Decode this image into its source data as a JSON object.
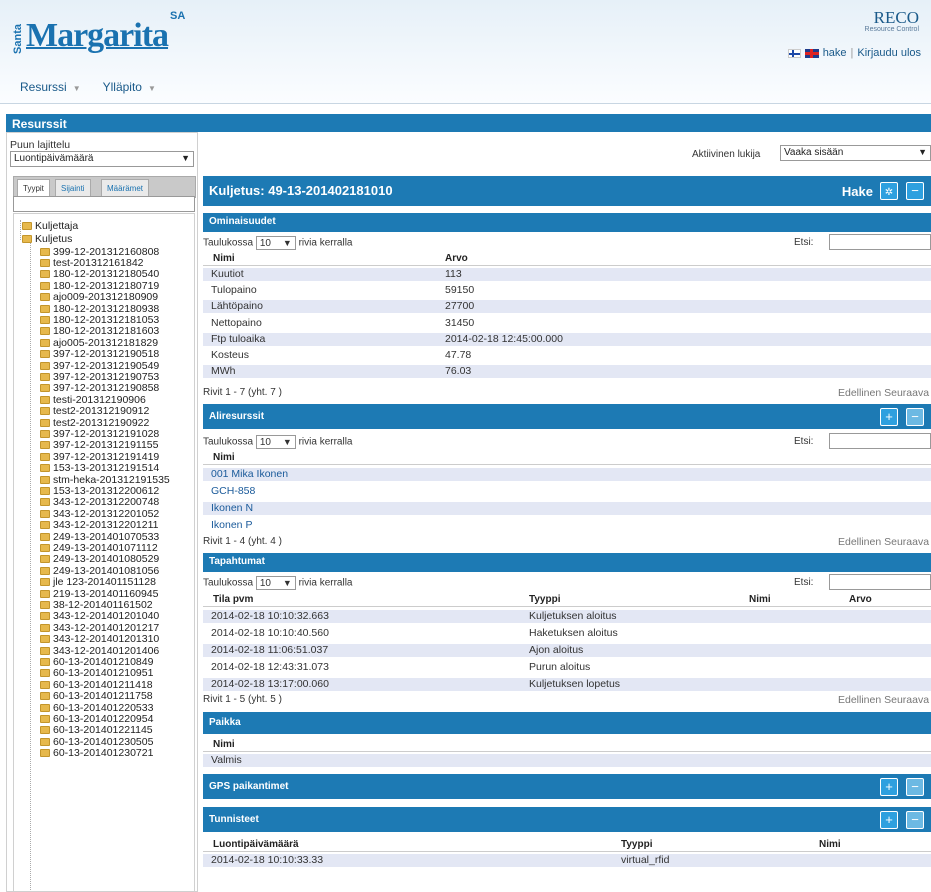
{
  "header": {
    "logo_vertical": "Santa",
    "logo_main": "Margarita",
    "logo_sup": "SA",
    "app_title": "RECO",
    "app_subtitle": "Resource Control",
    "link_hake": "hake",
    "separator": "|",
    "link_logout": "Kirjaudu ulos"
  },
  "menu": {
    "items": [
      "Resurssi",
      "Ylläpito"
    ],
    "arrow": "▼"
  },
  "resources_bar": "Resurssit",
  "tree_sort": {
    "label": "Puun lajittelu",
    "value": "Luontipäivämäärä"
  },
  "tabs": [
    "Tyypit",
    "Sijainti",
    "Määrämet"
  ],
  "tree": {
    "root_nodes": [
      "Kuljettaja",
      "Kuljetus"
    ],
    "children": [
      "399-12-201312160808",
      "test-201312161842",
      "180-12-201312180540",
      "180-12-201312180719",
      "ajo009-201312180909",
      "180-12-201312180938",
      "180-12-201312181053",
      "180-12-201312181603",
      "ajo005-201312181829",
      "397-12-201312190518",
      "397-12-201312190549",
      "397-12-201312190753",
      "397-12-201312190858",
      "testi-201312190906",
      "test2-201312190912",
      "test2-201312190922",
      "397-12-201312191028",
      "397-12-201312191155",
      "397-12-201312191419",
      "153-13-201312191514",
      "stm-heka-201312191535",
      "153-13-201312200612",
      "343-12-201312200748",
      "343-12-201312201052",
      "343-12-201312201211",
      "249-13-201401070533",
      "249-13-201401071112",
      "249-13-201401080529",
      "249-13-201401081056",
      "jle 123-201401151128",
      "219-13-201401160945",
      "38-12-201401161502",
      "343-12-201401201040",
      "343-12-201401201217",
      "343-12-201401201310",
      "343-12-201401201406",
      "60-13-201401210849",
      "60-13-201401210951",
      "60-13-201401211418",
      "60-13-201401211758",
      "60-13-201401220533",
      "60-13-201401220954",
      "60-13-201401221145",
      "60-13-201401230505",
      "60-13-201401230721"
    ]
  },
  "reader": {
    "label": "Aktiivinen lukija",
    "value": "Vaaka sisään"
  },
  "main": {
    "title": "Kuljetus: 49-13-201402181010",
    "hake_label": "Hake",
    "gear_icon": "✲",
    "minus_icon": "−"
  },
  "ominaisuudet": {
    "title": "Ominaisuudet",
    "show_prefix": "Taulukossa",
    "show_count": "10",
    "show_suffix": "rivia kerralla",
    "search_label": "Etsi:",
    "cols": [
      "Nimi",
      "Arvo"
    ],
    "rows": [
      [
        "Kuutiot",
        "113"
      ],
      [
        "Tulopaino",
        "59150"
      ],
      [
        "Lähtöpaino",
        "27700"
      ],
      [
        "Nettopaino",
        "31450"
      ],
      [
        "Ftp tuloaika",
        "2014-02-18 12:45:00.000"
      ],
      [
        "Kosteus",
        "47.78"
      ],
      [
        "MWh",
        "76.03"
      ]
    ],
    "info": "Rivit 1 - 7 (yht. 7 )",
    "prev": "Edellinen",
    "next": "Seuraava"
  },
  "aliresurssit": {
    "title": "Aliresurssit",
    "show_prefix": "Taulukossa",
    "show_count": "10",
    "show_suffix": "rivia kerralla",
    "search_label": "Etsi:",
    "cols": [
      "Nimi"
    ],
    "rows": [
      "001 Mika Ikonen",
      "GCH-858",
      "Ikonen N",
      "Ikonen P"
    ],
    "info": "Rivit 1 - 4 (yht. 4 )",
    "prev": "Edellinen",
    "next": "Seuraava"
  },
  "tapahtumat": {
    "title": "Tapahtumat",
    "show_prefix": "Taulukossa",
    "show_count": "10",
    "show_suffix": "rivia kerralla",
    "search_label": "Etsi:",
    "cols": [
      "Tila pvm",
      "Tyyppi",
      "Nimi",
      "Arvo"
    ],
    "rows": [
      [
        "2014-02-18 10:10:32.663",
        "Kuljetuksen aloitus"
      ],
      [
        "2014-02-18 10:10:40.560",
        "Haketuksen aloitus"
      ],
      [
        "2014-02-18 11:06:51.037",
        "Ajon aloitus"
      ],
      [
        "2014-02-18 12:43:31.073",
        "Purun aloitus"
      ],
      [
        "2014-02-18 13:17:00.060",
        "Kuljetuksen lopetus"
      ]
    ],
    "info": "Rivit 1 - 5 (yht. 5 )",
    "prev": "Edellinen",
    "next": "Seuraava"
  },
  "paikka": {
    "title": "Paikka",
    "cols": [
      "Nimi"
    ],
    "rows": [
      "Valmis"
    ]
  },
  "gps": {
    "title": "GPS paikantimet",
    "plus_icon": "+",
    "minus_icon": "−"
  },
  "tunnisteet": {
    "title": "Tunnisteet",
    "cols": [
      "Luontipäivämäärä",
      "Tyyppi",
      "Nimi"
    ],
    "rows": [
      [
        "2014-02-18 10:10:33.33",
        "virtual_rfid"
      ]
    ],
    "plus_icon": "+",
    "minus_icon": "−"
  }
}
